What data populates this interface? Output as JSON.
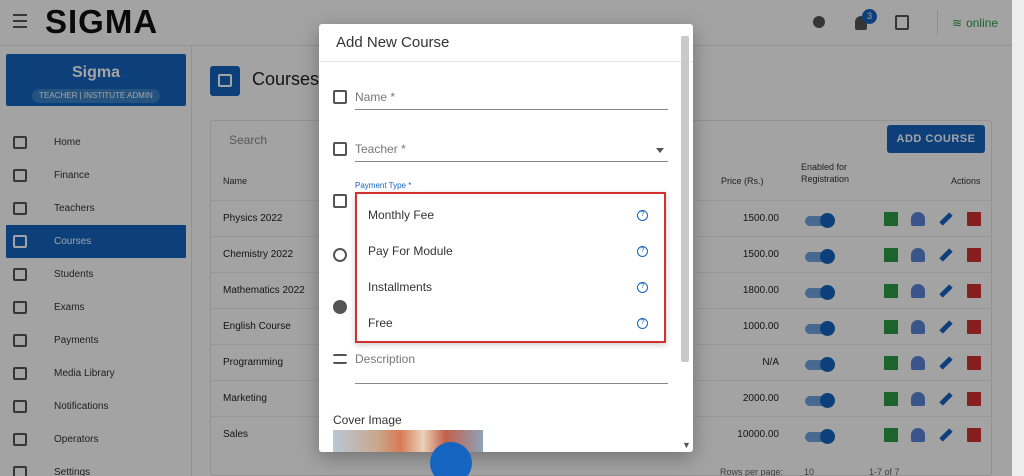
{
  "topbar": {
    "logo": "SIGMA",
    "notification_count": "3",
    "status": "online"
  },
  "sidebar": {
    "profile_name": "Sigma",
    "profile_role": "TEACHER | INSTITUTE ADMIN",
    "items": [
      {
        "label": "Home"
      },
      {
        "label": "Finance"
      },
      {
        "label": "Teachers"
      },
      {
        "label": "Courses"
      },
      {
        "label": "Students"
      },
      {
        "label": "Exams"
      },
      {
        "label": "Payments"
      },
      {
        "label": "Media Library"
      },
      {
        "label": "Notifications"
      },
      {
        "label": "Operators"
      },
      {
        "label": "Settings"
      }
    ]
  },
  "page": {
    "title": "Courses",
    "search_placeholder": "Search",
    "add_button": "ADD COURSE",
    "columns": {
      "name": "Name",
      "price": "Price (Rs.)",
      "enabled": "Enabled for Registration",
      "actions": "Actions"
    },
    "rows": [
      {
        "name": "Physics 2022",
        "price": "1500.00"
      },
      {
        "name": "Chemistry 2022",
        "price": "1500.00"
      },
      {
        "name": "Mathematics 2022",
        "price": "1800.00"
      },
      {
        "name": "English Course",
        "price": "1000.00"
      },
      {
        "name": "Programming",
        "price": "N/A"
      },
      {
        "name": "Marketing",
        "price": "2000.00"
      },
      {
        "name": "Sales",
        "price": "10000.00"
      }
    ],
    "rows_per_page_label": "Rows per page:",
    "rows_per_page_value": "10",
    "pagination": "1-7 of 7"
  },
  "dialog": {
    "title": "Add New Course",
    "name_label": "Name *",
    "teacher_label": "Teacher *",
    "payment_type_label": "Payment Type *",
    "payment_options": [
      {
        "label": "Monthly Fee"
      },
      {
        "label": "Pay For Module"
      },
      {
        "label": "Installments"
      },
      {
        "label": "Free"
      }
    ],
    "description_label": "Description",
    "cover_image_label": "Cover Image"
  }
}
